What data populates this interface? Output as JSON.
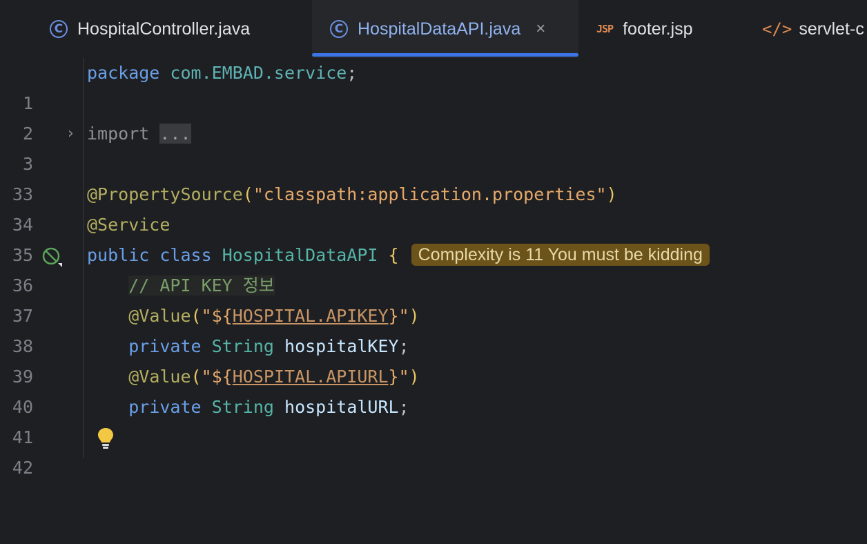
{
  "tabs": [
    {
      "label": "HospitalController.java",
      "icon": "java-class-icon",
      "active": false
    },
    {
      "label": "HospitalDataAPI.java",
      "icon": "java-class-icon",
      "active": true,
      "close": "×"
    },
    {
      "label": "footer.jsp",
      "icon": "jsp-file-icon",
      "badge": "JSP",
      "active": false
    },
    {
      "label": "servlet-c",
      "icon": "xml-file-icon",
      "active": false
    }
  ],
  "code": {
    "line_numbers": [
      "1",
      "2",
      "3",
      "33",
      "34",
      "35",
      "36",
      "37",
      "38",
      "39",
      "40",
      "41",
      "42"
    ],
    "l1": {
      "kw": "package",
      "pkg": "com.EMBAD.service",
      "semi": ";"
    },
    "l3": {
      "kw": "import",
      "fold": "..."
    },
    "l34": {
      "ann": "@PropertySource",
      "open": "(",
      "str": "\"classpath:application.properties\"",
      "close": ")"
    },
    "l35": {
      "ann": "@Service"
    },
    "l36": {
      "kw1": "public",
      "kw2": "class",
      "cls": "HospitalDataAPI",
      "brace": "{",
      "hint": "Complexity is 11 You must be kidding"
    },
    "l37": {
      "comment": "// API KEY 정보"
    },
    "l38": {
      "ann": "@Value",
      "open": "(",
      "q1": "\"${",
      "prop": "HOSPITAL.APIKEY",
      "q2": "}\"",
      "close": ")"
    },
    "l39": {
      "kw": "private",
      "type": "String",
      "field": "hospitalKEY",
      "semi": ";"
    },
    "l40": {
      "ann": "@Value",
      "open": "(",
      "q1": "\"${",
      "prop": "HOSPITAL.APIURL",
      "q2": "}\"",
      "close": ")"
    },
    "l41": {
      "kw": "private",
      "type": "String",
      "field": "hospitalURL",
      "semi": ";"
    }
  },
  "colors": {
    "background": "#1e1f22",
    "active_tab_text": "#8fb2ef",
    "tab_underline": "#3d74e6",
    "hint_background": "#6b531a"
  }
}
